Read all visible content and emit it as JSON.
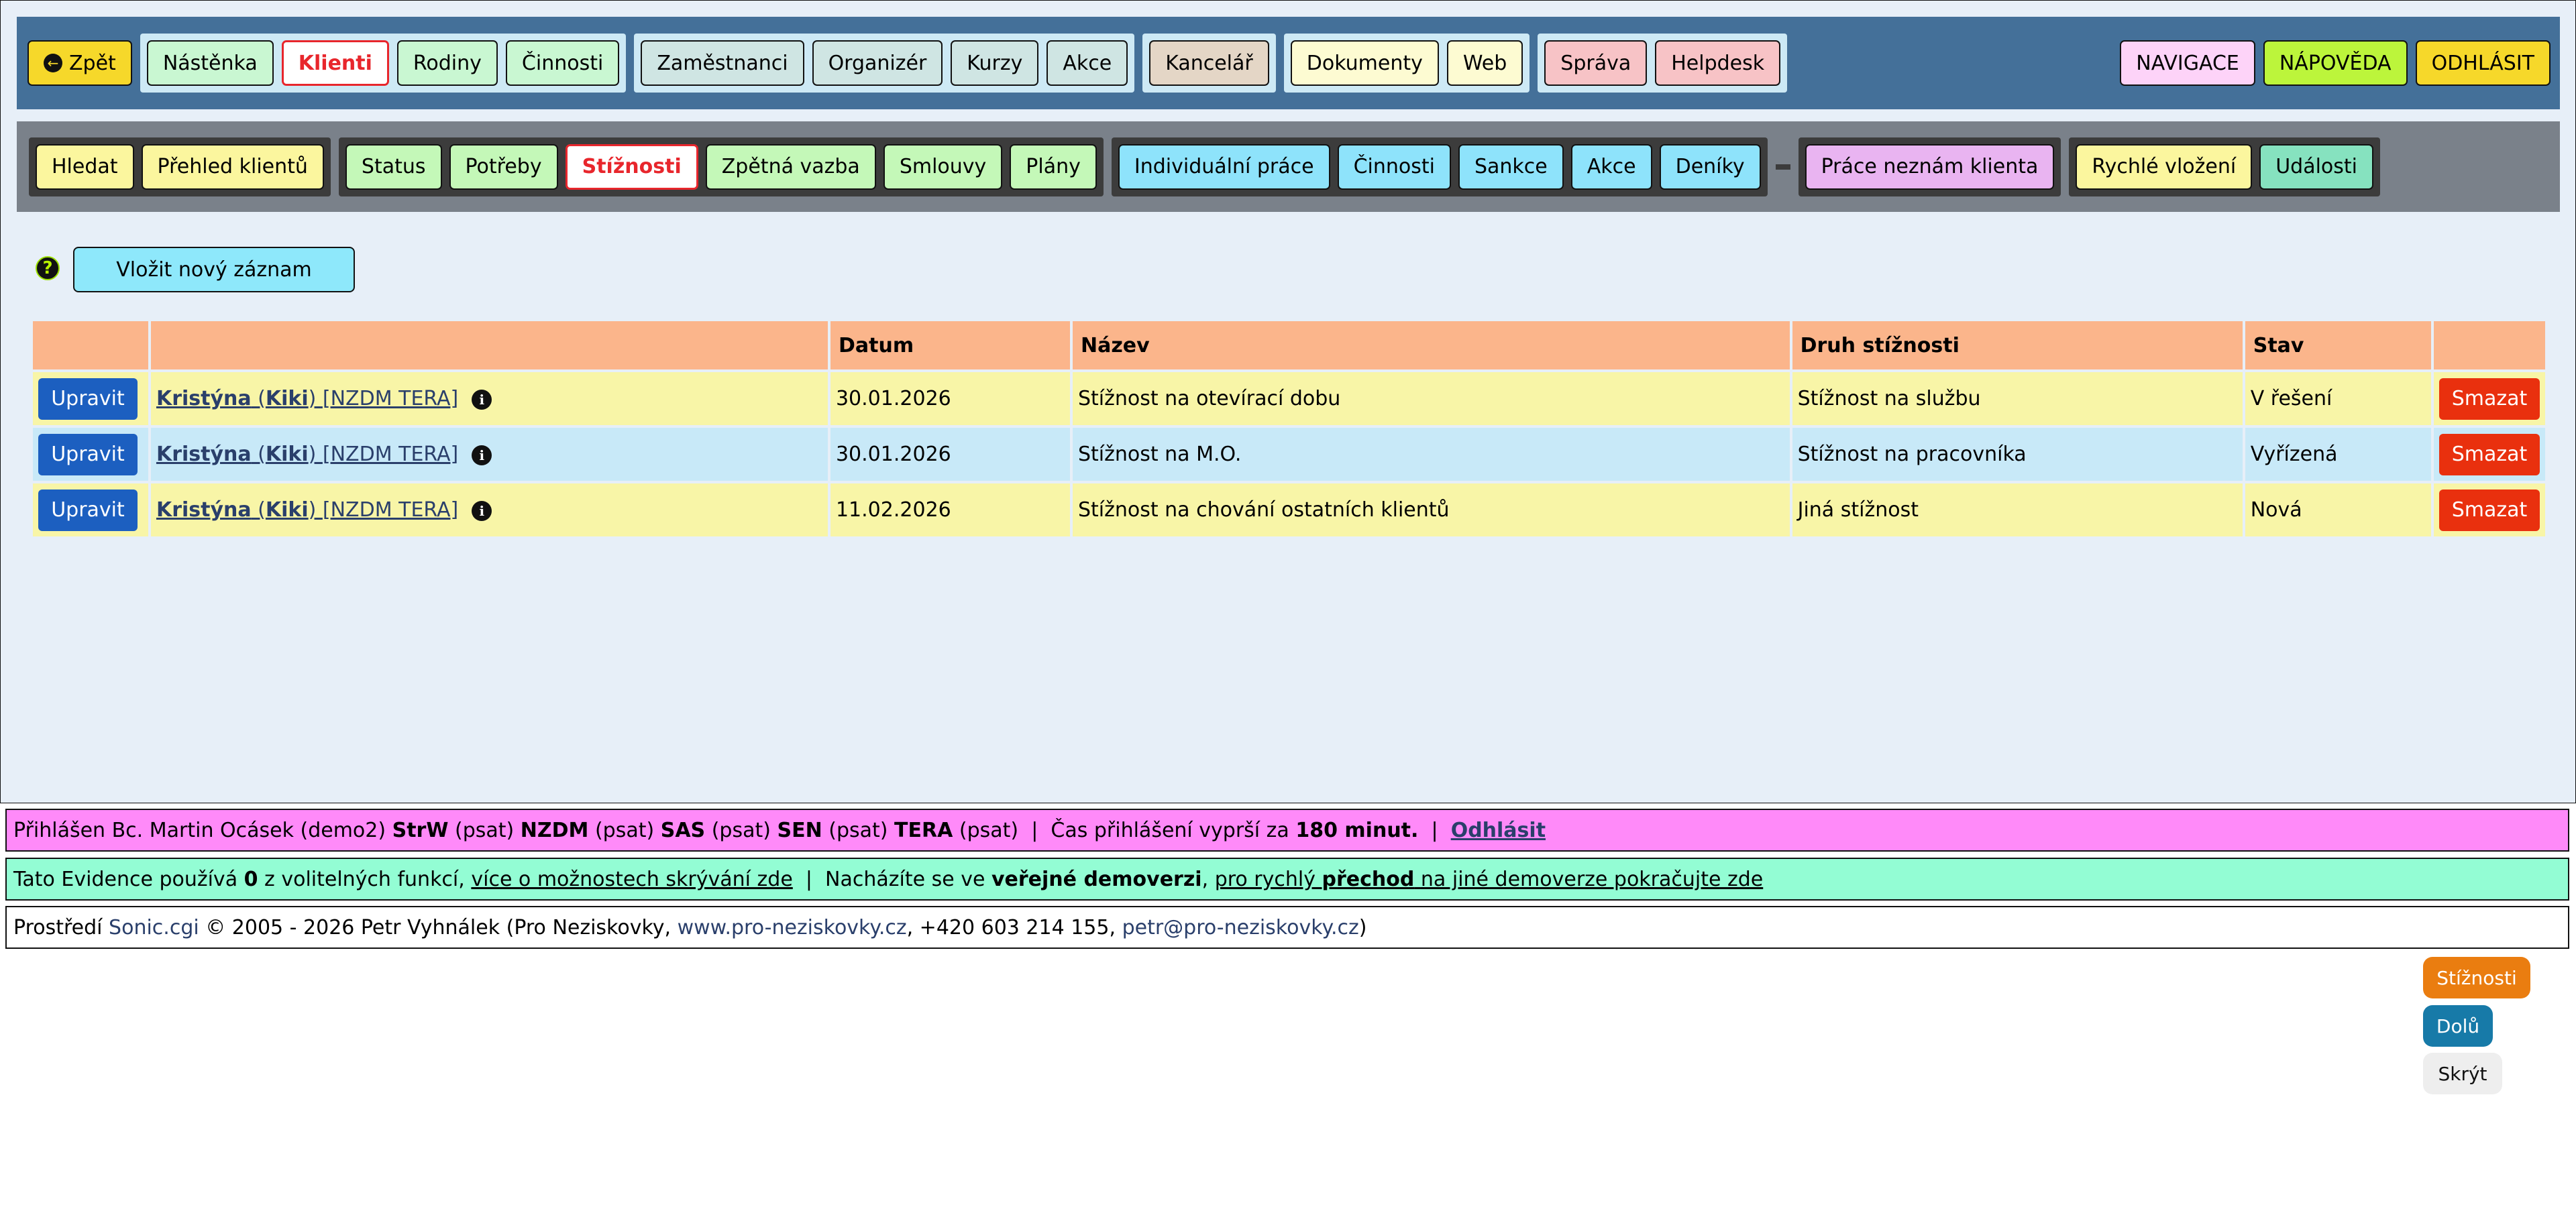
{
  "topnav": {
    "back": "Zpět",
    "groups": [
      [
        "Nástěnka",
        "Klienti",
        "Rodiny",
        "Činnosti"
      ],
      [
        "Zaměstnanci",
        "Organizér",
        "Kurzy",
        "Akce"
      ],
      [
        "Kancelář"
      ],
      [
        "Dokumenty",
        "Web"
      ],
      [
        "Správa",
        "Helpdesk"
      ]
    ],
    "right": [
      "NAVIGACE",
      "NÁPOVĚDA",
      "ODHLÁSIT"
    ],
    "active": "Klienti"
  },
  "subnav": {
    "groups": [
      [
        "Hledat",
        "Přehled klientů"
      ],
      [
        "Status",
        "Potřeby",
        "Stížnosti",
        "Zpětná vazba",
        "Smlouvy",
        "Plány"
      ],
      [
        "Individuální práce",
        "Činnosti",
        "Sankce",
        "Akce",
        "Deníky"
      ],
      [
        "Práce neznám klienta"
      ],
      [
        "Rychlé vložení",
        "Události"
      ]
    ],
    "active": "Stížnosti"
  },
  "content": {
    "help_icon": "question-icon",
    "new_record": "Vložit nový záznam",
    "table": {
      "headers": [
        "",
        "",
        "Datum",
        "Název",
        "Druh stížnosti",
        "Stav",
        ""
      ],
      "edit_label": "Upravit",
      "delete_label": "Smazat",
      "rows": [
        {
          "client_first": "Kristýna",
          "client_nick": "Kiki",
          "client_tags": "[NZDM TERA]",
          "date": "30.01.2026",
          "name": "Stížnost na otevírací dobu",
          "type": "Stížnost na službu",
          "status": "V řešení"
        },
        {
          "client_first": "Kristýna",
          "client_nick": "Kiki",
          "client_tags": "[NZDM TERA]",
          "date": "30.01.2026",
          "name": "Stížnost na M.O.",
          "type": "Stížnost na pracovníka",
          "status": "Vyřízená"
        },
        {
          "client_first": "Kristýna",
          "client_nick": "Kiki",
          "client_tags": "[NZDM TERA]",
          "date": "11.02.2026",
          "name": "Stížnost na chování ostatních klientů",
          "type": "Jiná stížnost",
          "status": "Nová"
        }
      ]
    }
  },
  "footer": {
    "login": {
      "prefix": "Přihlášen Bc. Martin Ocásek (demo2)",
      "units": [
        {
          "code": "StrW",
          "perm": "(psat)"
        },
        {
          "code": "NZDM",
          "perm": "(psat)"
        },
        {
          "code": "SAS",
          "perm": "(psat)"
        },
        {
          "code": "SEN",
          "perm": "(psat)"
        },
        {
          "code": "TERA",
          "perm": "(psat)"
        }
      ],
      "sep": "|",
      "expiry_text": "Čas přihlášení vyprší za",
      "expiry_value": "180 minut.",
      "logout": "Odhlásit"
    },
    "evidence": {
      "t1": "Tato Evidence používá",
      "count": "0",
      "t2": "z volitelných funkcí,",
      "link1": "více o možnostech skrývání zde",
      "sep": "|",
      "t3": "Nacházíte se ve",
      "bold1": "veřejné demoverzi",
      "t4": ",",
      "link2a": "pro rychlý",
      "link2b": "přechod",
      "link2c": "na jiné demoverze pokračujte zde"
    },
    "credits": {
      "t1": "Prostředí",
      "product": "Sonic.cgi",
      "t2": "© 2005 - 2026 Petr Vyhnálek (Pro Neziskovky,",
      "web": "www.pro-neziskovky.cz",
      "t3": ", +420 603 214 155,",
      "email": "petr@pro-neziskovky.cz",
      "t4": ")"
    }
  },
  "floating": [
    "Stížnosti",
    "Dolů",
    "Skrýt"
  ],
  "colors": {
    "topbar": "#447099",
    "subbar": "#7a818a",
    "page_bg": "#e7eff8",
    "header_row": "#fbb58b",
    "row_yellow": "#f8f5a7",
    "row_blue": "#c8e9f8",
    "edit": "#1c5fc0",
    "delete": "#e9300e"
  }
}
